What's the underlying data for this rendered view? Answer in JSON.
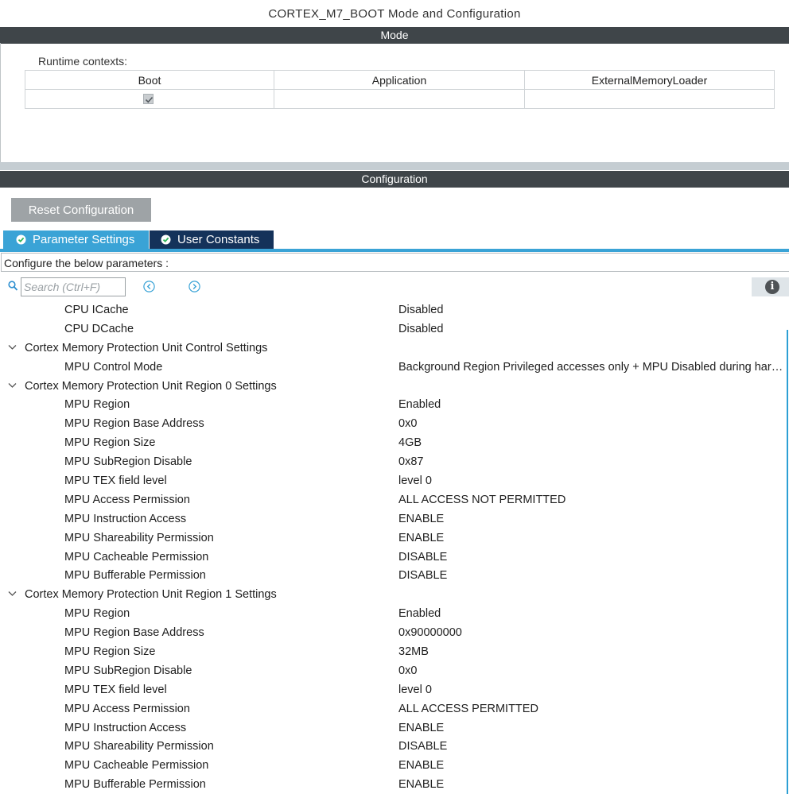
{
  "window": {
    "title": "CORTEX_M7_BOOT Mode and Configuration"
  },
  "mode": {
    "header": "Mode",
    "runtime_label": "Runtime contexts:",
    "columns": [
      "Boot",
      "Application",
      "ExternalMemoryLoader"
    ],
    "boot_checked": true
  },
  "configuration": {
    "header": "Configuration",
    "reset_label": "Reset Configuration",
    "tabs": [
      {
        "label": "Parameter Settings",
        "active": true
      },
      {
        "label": "User Constants",
        "active": false
      }
    ],
    "configure_label": "Configure the below parameters :",
    "search_placeholder": "Search (Ctrl+F)"
  },
  "tree": [
    {
      "type": "param",
      "label": "CPU ICache",
      "value": "Disabled"
    },
    {
      "type": "param",
      "label": "CPU DCache",
      "value": "Disabled"
    },
    {
      "type": "group",
      "label": "Cortex Memory Protection Unit Control Settings"
    },
    {
      "type": "param",
      "label": "MPU Control Mode",
      "value": "Background Region Privileged accesses only + MPU Disabled during hard fault, NMI and FAULTMASK handlers"
    },
    {
      "type": "group",
      "label": "Cortex Memory Protection Unit Region 0 Settings"
    },
    {
      "type": "param",
      "label": "MPU Region",
      "value": "Enabled"
    },
    {
      "type": "param",
      "label": "MPU Region Base Address",
      "value": "0x0"
    },
    {
      "type": "param",
      "label": "MPU Region Size",
      "value": "4GB"
    },
    {
      "type": "param",
      "label": "MPU SubRegion Disable",
      "value": "0x87"
    },
    {
      "type": "param",
      "label": "MPU TEX field level",
      "value": "level 0"
    },
    {
      "type": "param",
      "label": "MPU Access Permission",
      "value": "ALL ACCESS NOT PERMITTED"
    },
    {
      "type": "param",
      "label": "MPU Instruction Access",
      "value": "ENABLE"
    },
    {
      "type": "param",
      "label": "MPU Shareability Permission",
      "value": "ENABLE"
    },
    {
      "type": "param",
      "label": "MPU Cacheable Permission",
      "value": "DISABLE"
    },
    {
      "type": "param",
      "label": "MPU Bufferable  Permission",
      "value": "DISABLE"
    },
    {
      "type": "group",
      "label": "Cortex Memory Protection Unit Region 1 Settings"
    },
    {
      "type": "param",
      "label": "MPU Region",
      "value": "Enabled"
    },
    {
      "type": "param",
      "label": "MPU Region Base Address",
      "value": "0x90000000"
    },
    {
      "type": "param",
      "label": "MPU Region Size",
      "value": "32MB"
    },
    {
      "type": "param",
      "label": "MPU SubRegion Disable",
      "value": "0x0"
    },
    {
      "type": "param",
      "label": "MPU TEX field level",
      "value": "level 0"
    },
    {
      "type": "param",
      "label": "MPU Access Permission",
      "value": "ALL ACCESS PERMITTED"
    },
    {
      "type": "param",
      "label": "MPU Instruction Access",
      "value": "ENABLE"
    },
    {
      "type": "param",
      "label": "MPU Shareability Permission",
      "value": "DISABLE"
    },
    {
      "type": "param",
      "label": "MPU Cacheable Permission",
      "value": "ENABLE"
    },
    {
      "type": "param",
      "label": "MPU Bufferable  Permission",
      "value": "ENABLE"
    }
  ],
  "colors": {
    "header_bar": "#3f4549",
    "tab_active": "#3aa3d6",
    "tab_inactive": "#14325a",
    "reset_button": "#9ea3a6",
    "check_mark": "#2fb55a"
  },
  "icons": {
    "search": "search-icon",
    "prev": "chevron-left-circle-icon",
    "next": "chevron-right-circle-icon",
    "info": "info-icon",
    "tab_status": "check-circle-icon",
    "group_expand": "chevron-down-icon"
  }
}
